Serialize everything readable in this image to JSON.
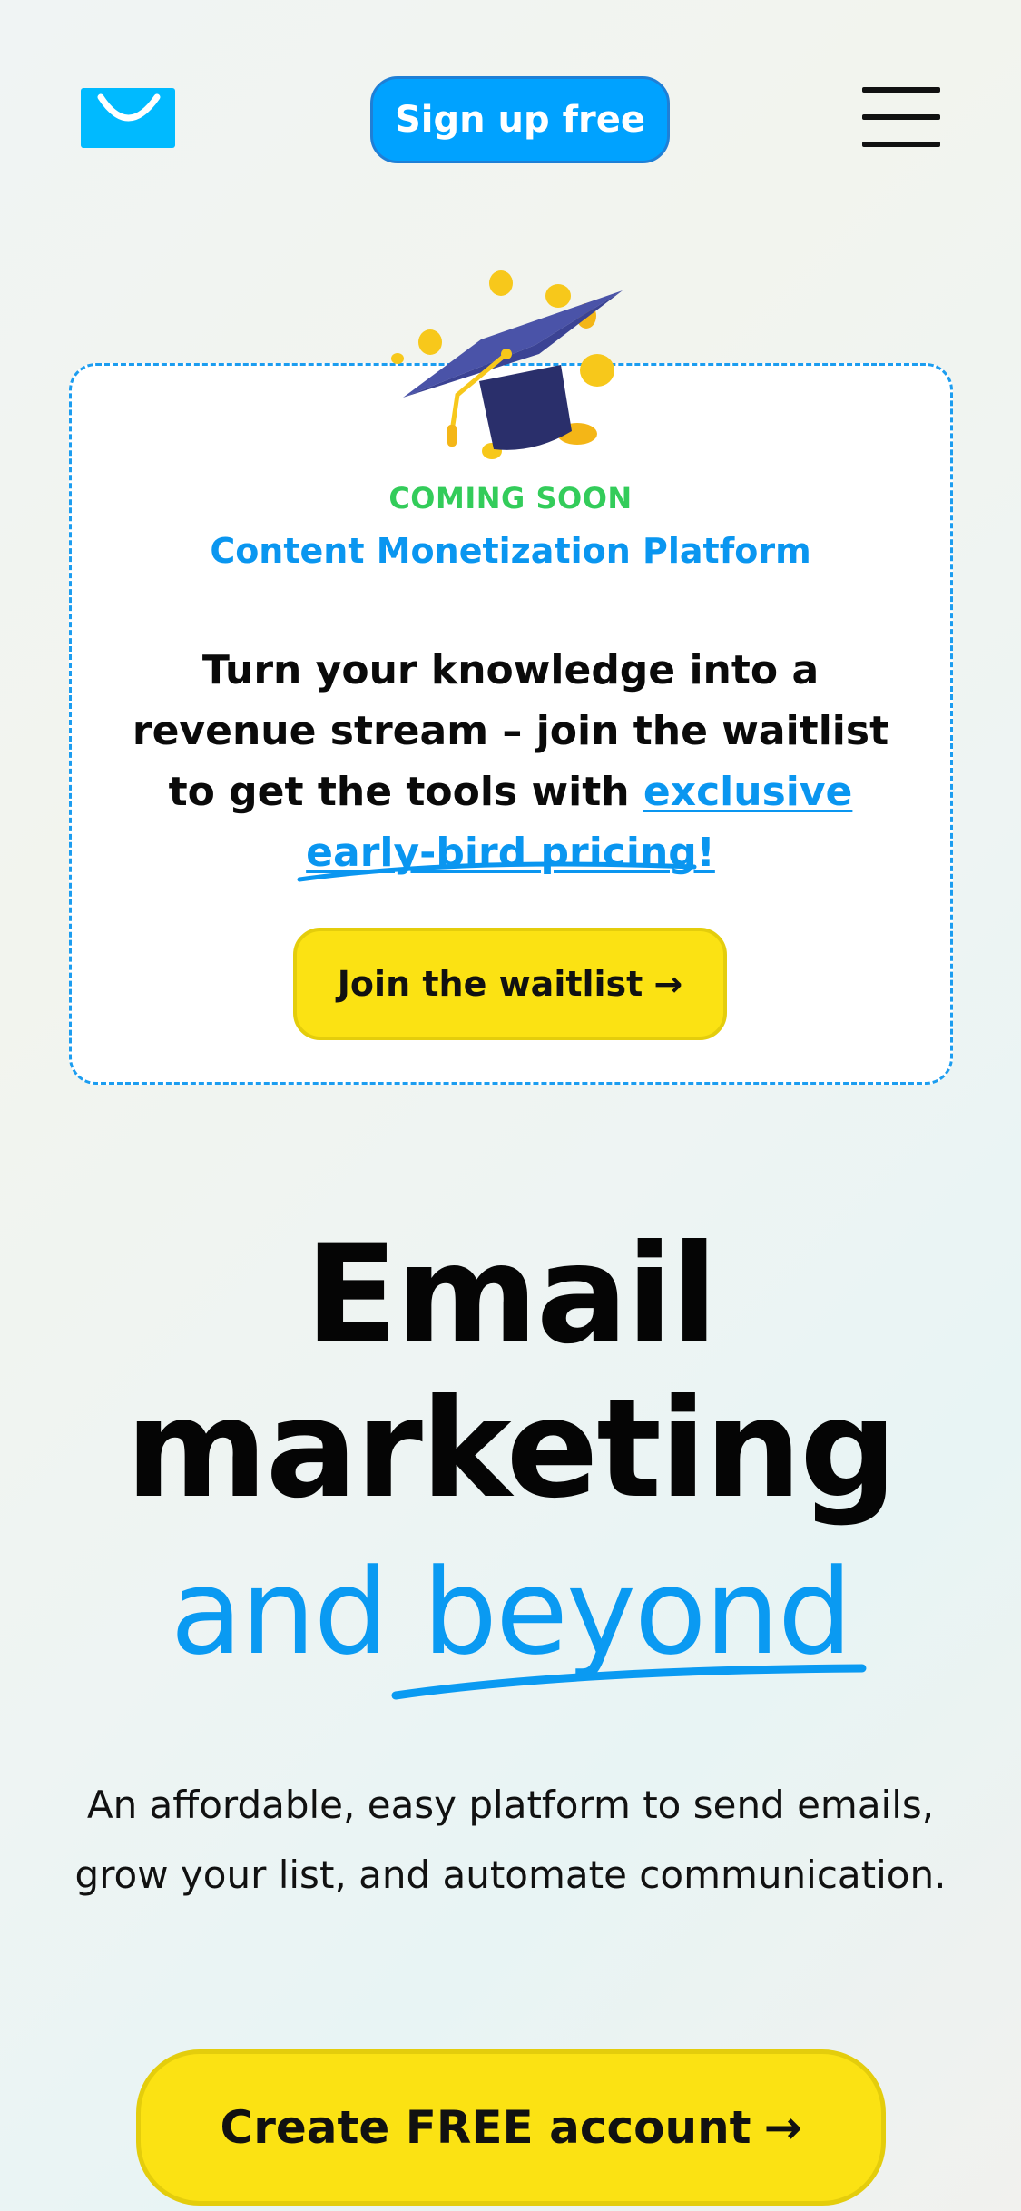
{
  "header": {
    "logo_icon": "smile-envelope-logo",
    "signup_label": "Sign up free",
    "menu_icon": "hamburger-menu-icon"
  },
  "promo": {
    "illustration": "graduation-cap-with-coins",
    "badge": "COMING SOON",
    "title": "Content Monetization Platform",
    "text_before_link": "Turn your knowledge into a revenue stream – join the waitlist to get the tools with ",
    "link_text": "exclusive early-bird pricing!",
    "button_label": "Join the waitlist",
    "button_arrow": "→"
  },
  "hero": {
    "line1": "Email",
    "line2": "marketing",
    "line3": "and beyond",
    "description": "An affordable, easy platform to send emails, grow your list, and automate communication.",
    "cta_label": "Create FREE account",
    "cta_arrow": "→"
  },
  "colors": {
    "brand_blue": "#00a2ff",
    "accent_yellow": "#fbe213",
    "badge_green": "#33cc5a"
  }
}
